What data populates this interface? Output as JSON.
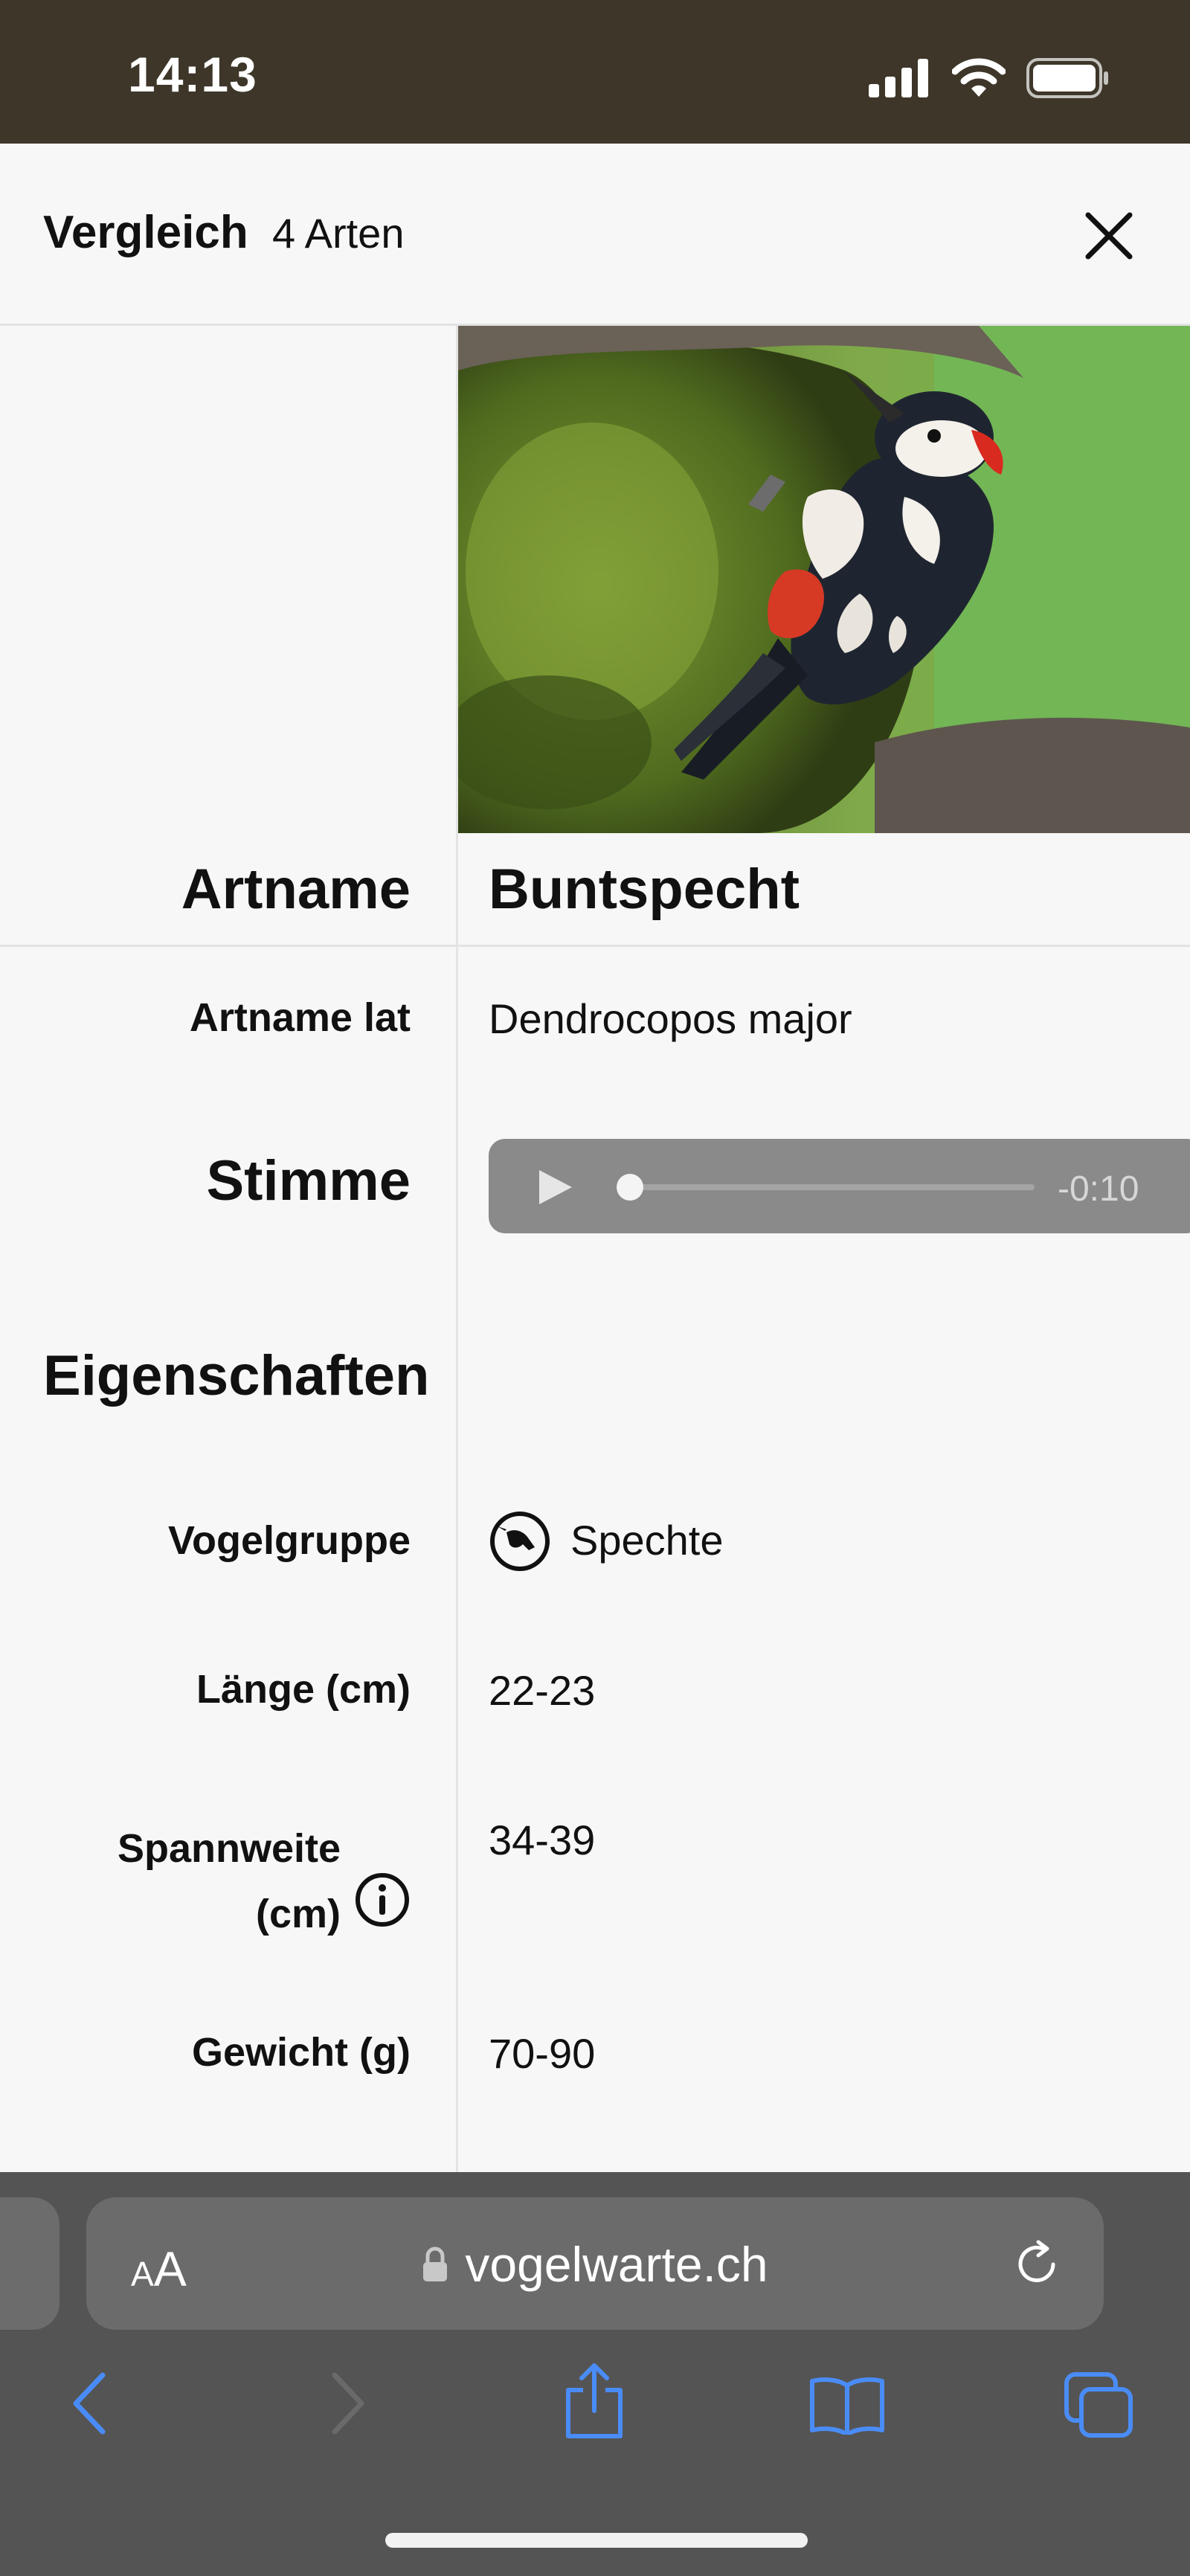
{
  "status_bar": {
    "time": "14:13",
    "icons": [
      "cellular-signal-icon",
      "wifi-icon",
      "battery-icon"
    ]
  },
  "header": {
    "title": "Vergleich",
    "count": "4 Arten",
    "close_icon": "close-icon"
  },
  "species": {
    "photo_alt": "Buntspecht",
    "delete_icon": "trash-icon",
    "rows": {
      "artname": {
        "label": "Artname",
        "value": "Buntspecht"
      },
      "artname_lat": {
        "label": "Artname lat",
        "value": "Dendrocopos major"
      },
      "stimme": {
        "label": "Stimme",
        "audio_time": "-0:10",
        "audio_progress": 0.0
      }
    }
  },
  "eigenschaften": {
    "title": "Eigenschaften",
    "vogelgruppe": {
      "label": "Vogelgruppe",
      "value": "Spechte",
      "icon": "woodpecker-icon"
    },
    "laenge": {
      "label": "Länge (cm)",
      "value": "22-23"
    },
    "spannweite": {
      "label_line1": "Spannweite",
      "label_line2": "(cm)",
      "value": "34-39",
      "icon": "info-icon"
    },
    "gewicht": {
      "label": "Gewicht (g)",
      "value": "70-90"
    }
  },
  "browser": {
    "aa_label_small": "A",
    "aa_label_large": "A",
    "url": "vogelwarte.ch",
    "colors": {
      "toolbar_bg": "#545454",
      "icon_blue": "#4a8cf7",
      "status_bg": "#3d3629"
    }
  }
}
